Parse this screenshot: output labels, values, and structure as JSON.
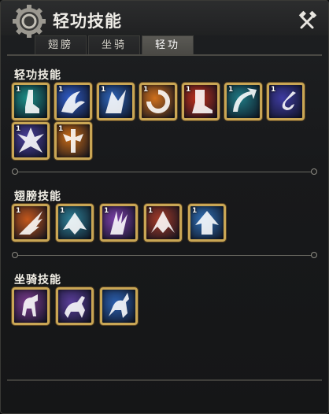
{
  "header": {
    "title": "轻功技能"
  },
  "tabs": [
    {
      "label": "翅膀",
      "active": false
    },
    {
      "label": "坐骑",
      "active": false
    },
    {
      "label": "轻功",
      "active": true
    }
  ],
  "sections": [
    {
      "title": "轻功技能",
      "skills": [
        {
          "icon": "foot-icon",
          "level": "1",
          "color": "#1b8f88"
        },
        {
          "icon": "wave-icon",
          "level": "1",
          "color": "#2f5cc6"
        },
        {
          "icon": "wing-dash-icon",
          "level": "1",
          "color": "#2d63b8"
        },
        {
          "icon": "fire-ring-icon",
          "level": "1",
          "color": "#d0701c"
        },
        {
          "icon": "fire-boot-icon",
          "level": "1",
          "color": "#c0301c"
        },
        {
          "icon": "arrow-curve-icon",
          "level": "1",
          "color": "#1f7a84"
        },
        {
          "icon": "hook-icon",
          "level": "1",
          "color": "#3d3aa0"
        },
        {
          "icon": "crystal-icon",
          "level": "1",
          "color": "#4a3f9c"
        },
        {
          "icon": "fire-cross-icon",
          "level": "1",
          "color": "#c86a14"
        }
      ]
    },
    {
      "title": "翅膀技能",
      "skills": [
        {
          "icon": "fire-wing-icon",
          "level": "1",
          "color": "#c4571c"
        },
        {
          "icon": "light-wing-icon",
          "level": "1",
          "color": "#2d7f95"
        },
        {
          "icon": "purple-wing-icon",
          "level": "1",
          "color": "#7b3fa8"
        },
        {
          "icon": "flame-crown-icon",
          "level": "1",
          "color": "#a43a28"
        },
        {
          "icon": "ice-wing-icon",
          "level": "1",
          "color": "#2f6fb6"
        }
      ]
    },
    {
      "title": "坐骑技能",
      "skills": [
        {
          "icon": "horse-icon",
          "level": "",
          "color": "#7a3a8e"
        },
        {
          "icon": "deer-icon",
          "level": "",
          "color": "#5a3d9a"
        },
        {
          "icon": "pegasus-icon",
          "level": "",
          "color": "#2b5fae"
        }
      ]
    }
  ]
}
